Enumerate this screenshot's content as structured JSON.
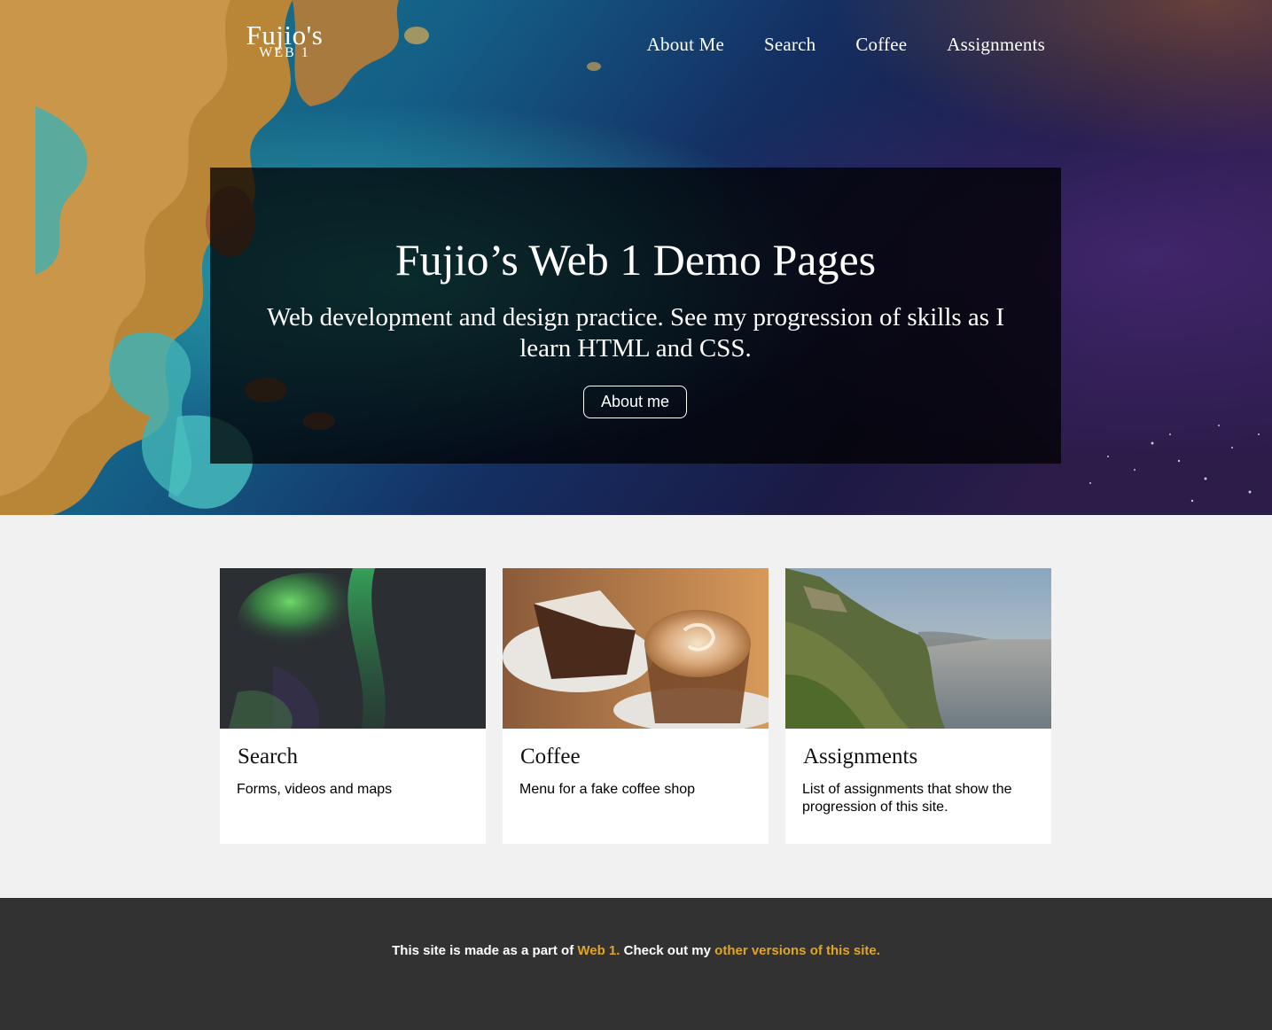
{
  "brand": {
    "name": "Fujio's",
    "sub": "WEB 1"
  },
  "nav": {
    "items": [
      {
        "label": "About Me"
      },
      {
        "label": "Search"
      },
      {
        "label": "Coffee"
      },
      {
        "label": "Assignments"
      }
    ]
  },
  "hero": {
    "title": "Fujio’s Web 1 Demo Pages",
    "subtitle": "Web development and design practice. See my progression of skills as I learn HTML and CSS.",
    "button_label": "About me"
  },
  "cards": [
    {
      "title": "Search",
      "description": "Forms, videos and maps",
      "image": "aurora-photo"
    },
    {
      "title": "Coffee",
      "description": "Menu for a fake coffee shop",
      "image": "coffee-and-cake-photo"
    },
    {
      "title": "Assignments",
      "description": "List of assignments that show the progression of this site.",
      "image": "coastal-cliffs-photo"
    }
  ],
  "footer": {
    "text_before": "This site is made as a part of ",
    "link1": "Web 1.",
    "text_middle": " Check out my ",
    "link2": "other versions of this site.",
    "link_color": "#e0a524",
    "background": "#323232"
  }
}
